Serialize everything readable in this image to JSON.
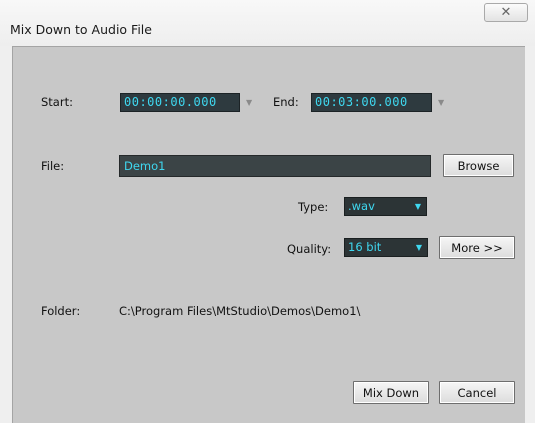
{
  "window": {
    "title": "Mix Down to Audio File",
    "close_glyph": "✕"
  },
  "range": {
    "start_label": "Start:",
    "start_value": "00:00:00.000",
    "end_label": "End:",
    "end_value": "00:03:00.000"
  },
  "file": {
    "label": "File:",
    "value": "Demo1",
    "browse_label": "Browse"
  },
  "type": {
    "label": "Type:",
    "value": ".wav"
  },
  "quality": {
    "label": "Quality:",
    "value": "16 bit",
    "more_label": "More >>"
  },
  "folder": {
    "label": "Folder:",
    "path": "C:\\Program Files\\MtStudio\\Demos\\Demo1\\"
  },
  "actions": {
    "mixdown_label": "Mix Down",
    "cancel_label": "Cancel"
  },
  "icons": {
    "spin": "caret-down-icon",
    "dropdown": "dropdown-arrow-icon",
    "close": "close-icon"
  },
  "colors": {
    "field_text": "#3fd8f0",
    "panel_bg": "#c8c8c8",
    "field_bg": "#2e3a3f"
  }
}
